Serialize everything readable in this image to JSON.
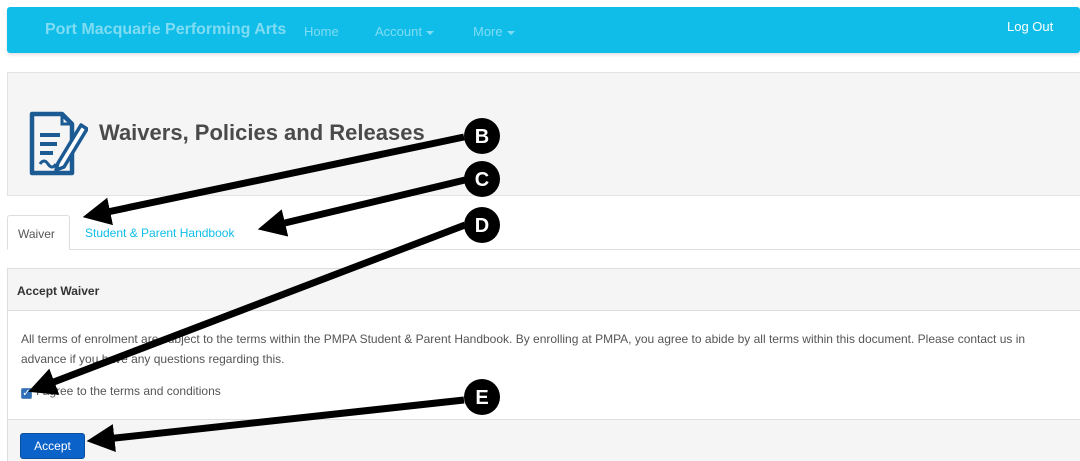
{
  "navbar": {
    "brand": "Port Macquarie Performing Arts",
    "items": [
      {
        "label": "Home"
      },
      {
        "label": "Account"
      },
      {
        "label": "More"
      }
    ],
    "logout": "Log Out",
    "color": "#10bde8"
  },
  "header": {
    "icon": "document-edit-icon",
    "title": "Waivers, Policies and Releases"
  },
  "tabs": [
    {
      "label": "Waiver",
      "active": true
    },
    {
      "label": "Student & Parent Handbook",
      "active": false
    }
  ],
  "card": {
    "title": "Accept Waiver",
    "text": "All terms of enrolment are subject to the terms within the PMPA Student & Parent Handbook. By enrolling at PMPA, you agree to abide by all terms within this document. Please contact us in advance if you have any questions regarding this.",
    "checkbox_label": "I agree to the terms and conditions",
    "checked": true,
    "button": "Accept"
  },
  "callouts": [
    "B",
    "C",
    "D",
    "E"
  ]
}
